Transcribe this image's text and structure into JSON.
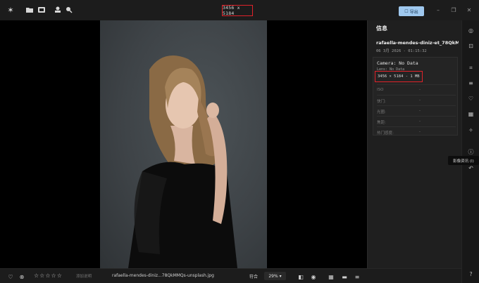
{
  "titlebar": {
    "dimensions": "3456 x 5184",
    "export_label": "导出",
    "icons": [
      "sparkle-icon",
      "folder-icon",
      "album-icon",
      "stamp-icon",
      "search-person-icon"
    ]
  },
  "info": {
    "title": "信息",
    "filename": "rafaella-mendes-diniz-et_78QkMMQs",
    "datetime": "06 3月 2026 - 01:15:32",
    "camera": "Camera: No Data",
    "lens": "Lens: No Data",
    "dims_size": "3456 × 5184 - 1 MB",
    "rows": [
      {
        "key": "ISO",
        "value": "-"
      },
      {
        "key": "快门:",
        "value": "-"
      },
      {
        "key": "光圈:",
        "value": "-"
      },
      {
        "key": "焦距:",
        "value": "-"
      },
      {
        "key": "热门感度:",
        "value": "-"
      }
    ]
  },
  "tooltip": "影像资讯 (I)",
  "bottombar": {
    "add_label": "添加说明",
    "filename": "rafaella-mendes-diniz...78QkMMQs-unsplash.jpg",
    "fit_label": "符合",
    "zoom": "29%"
  },
  "colors": {
    "accent": "#9fc8ee",
    "highlight": "#e0222a"
  }
}
